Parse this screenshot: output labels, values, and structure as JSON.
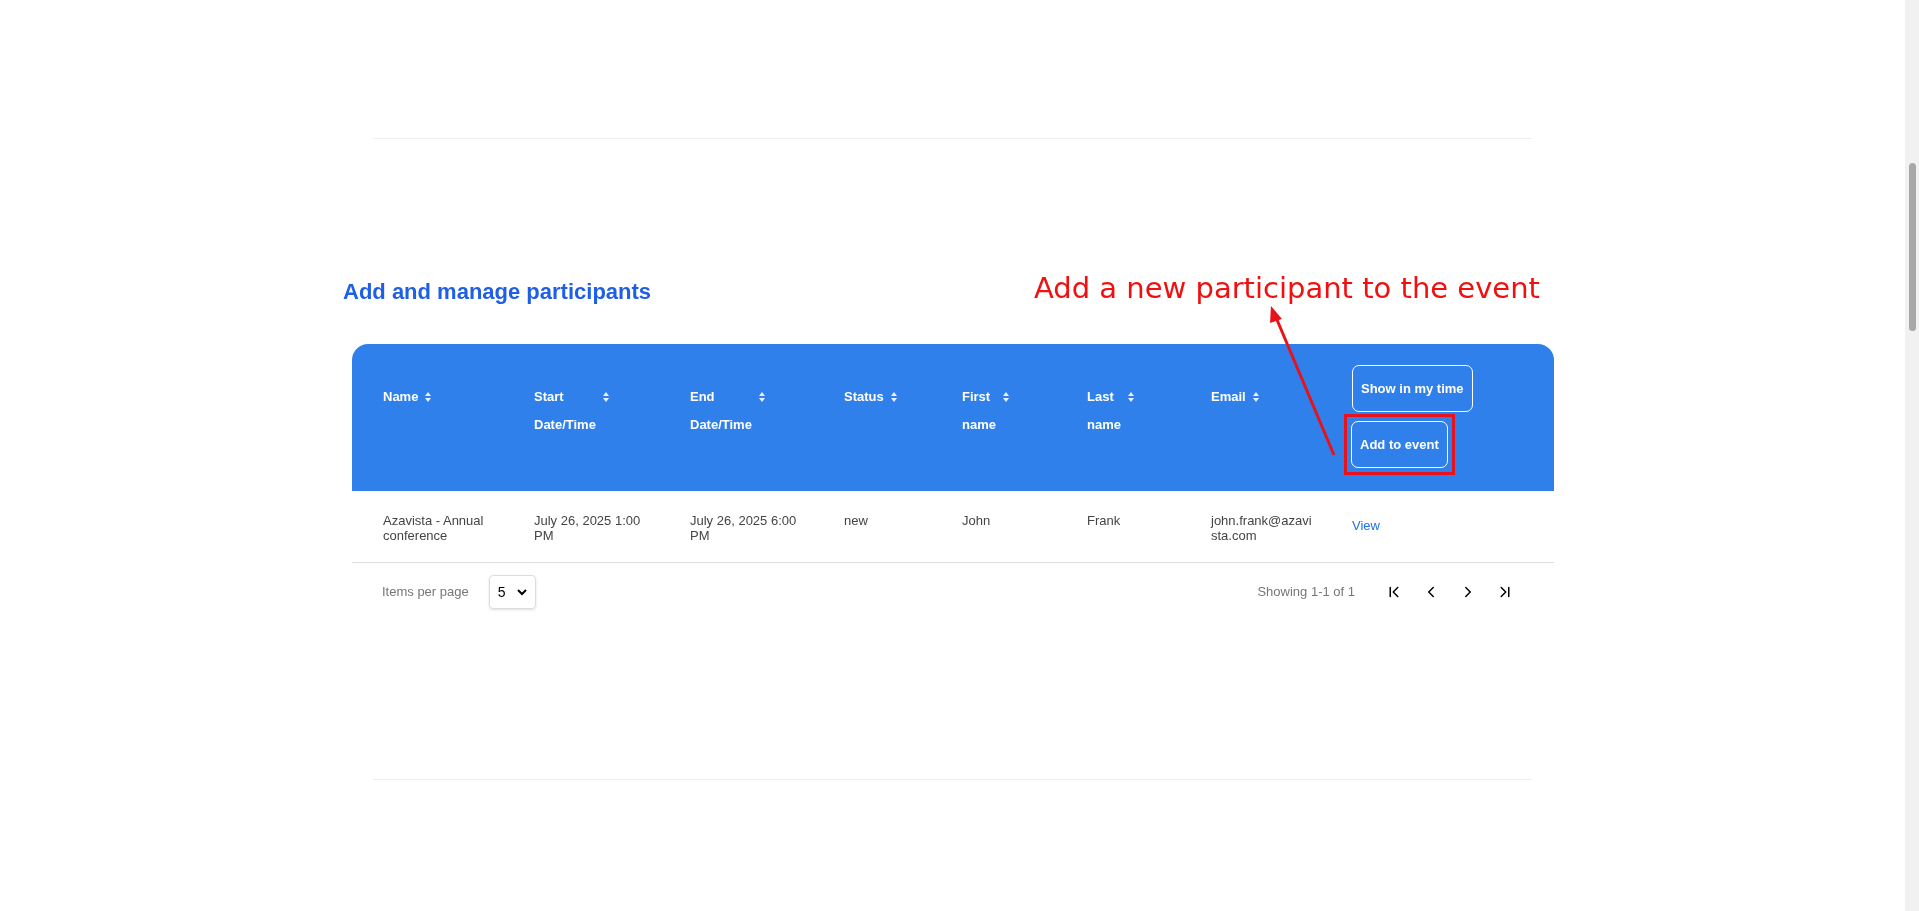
{
  "section": {
    "title": "Add and manage participants"
  },
  "annotation": {
    "text": "Add a new participant to the event"
  },
  "table": {
    "columns": [
      {
        "label": "Name",
        "sortable": true
      },
      {
        "label": "Start Date/Time",
        "sortable": true
      },
      {
        "label": "End Date/Time",
        "sortable": true
      },
      {
        "label": "Status",
        "sortable": true
      },
      {
        "label": "First name",
        "sortable": true
      },
      {
        "label": "Last name",
        "sortable": true
      },
      {
        "label": "Email",
        "sortable": true
      }
    ],
    "header_buttons": [
      {
        "label": "Show in my time",
        "highlighted": false
      },
      {
        "label": "Add to event",
        "highlighted": true
      }
    ],
    "rows": [
      {
        "cells": [
          "Azavista - Annual conference",
          "July 26, 2025 1:00 PM",
          "July 26, 2025 6:00 PM",
          "new",
          "John",
          "Frank",
          "john.frank@azavista.com"
        ],
        "action": "View"
      }
    ]
  },
  "pagination": {
    "items_per_page_label": "Items per page",
    "page_size": "5",
    "showing": "Showing 1-1 of 1"
  }
}
